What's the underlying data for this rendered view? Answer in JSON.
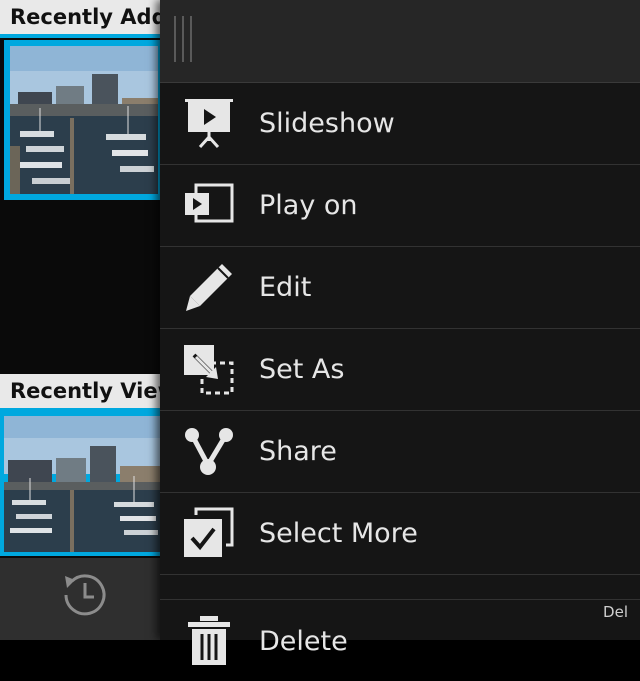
{
  "gallery": {
    "recently_added": "Recently Added",
    "recently_viewed": "Recently Viewed",
    "history_icon": "history-icon",
    "accent_color": "#00a8df"
  },
  "menu": {
    "items": [
      {
        "label": "Slideshow",
        "icon": "slideshow-icon"
      },
      {
        "label": "Play on",
        "icon": "play-on-icon"
      },
      {
        "label": "Edit",
        "icon": "pencil-icon"
      },
      {
        "label": "Set As",
        "icon": "set-as-icon"
      },
      {
        "label": "Share",
        "icon": "share-icon"
      },
      {
        "label": "Select More",
        "icon": "select-more-icon"
      },
      {
        "label": "Delete",
        "icon": "trash-icon"
      }
    ],
    "delete_shortcut": "Del"
  }
}
